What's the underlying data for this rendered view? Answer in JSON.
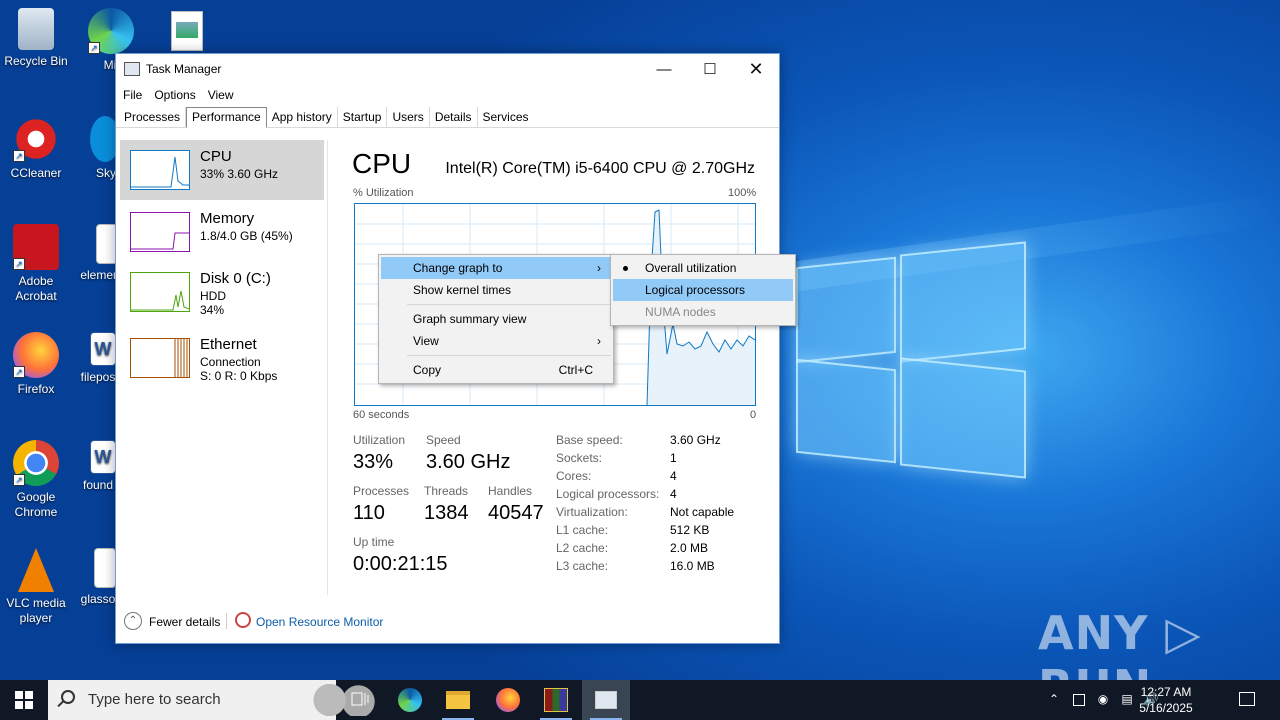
{
  "desktop": {
    "icons": [
      {
        "name": "recycle-bin-icon",
        "label": "Recycle Bin"
      },
      {
        "name": "edge-icon",
        "label": "Micro Ed"
      },
      {
        "name": "ccleaner-icon",
        "label": "CCleaner"
      },
      {
        "name": "skype-icon",
        "label": "Sky"
      },
      {
        "name": "acrobat-icon",
        "label": "Adobe Acrobat"
      },
      {
        "name": "element-icon",
        "label": "elemen"
      },
      {
        "name": "firefox-icon",
        "label": "Firefox"
      },
      {
        "name": "filepos-icon",
        "label": "filepos"
      },
      {
        "name": "chrome-icon",
        "label": "Google Chrome"
      },
      {
        "name": "found-icon",
        "label": "found"
      },
      {
        "name": "vlc-icon",
        "label": "VLC media player"
      },
      {
        "name": "glasso-icon",
        "label": "glasso"
      }
    ],
    "watermark": "ANY ▷ RUN"
  },
  "window": {
    "title": "Task Manager",
    "menu": [
      "File",
      "Options",
      "View"
    ],
    "tabs": [
      "Processes",
      "Performance",
      "App history",
      "Startup",
      "Users",
      "Details",
      "Services"
    ],
    "active_tab": "Performance"
  },
  "sidebar": {
    "items": [
      {
        "name": "CPU",
        "line2": "33%  3.60 GHz",
        "line3": "",
        "color": "#1178c5"
      },
      {
        "name": "Memory",
        "line2": "1.8/4.0 GB (45%)",
        "line3": "",
        "color": "#8b12ae"
      },
      {
        "name": "Disk 0 (C:)",
        "line2": "HDD",
        "line3": "34%",
        "color": "#4da60c"
      },
      {
        "name": "Ethernet",
        "line2": "Connection",
        "line3": "S: 0 R: 0 Kbps",
        "color": "#a74f01"
      }
    ]
  },
  "cpu": {
    "title": "CPU",
    "model": "Intel(R) Core(TM) i5-6400 CPU @ 2.70GHz",
    "graph_label_left": "% Utilization",
    "graph_label_right": "100%",
    "graph_bottom_left": "60 seconds",
    "graph_bottom_right": "0",
    "stats": {
      "utilization_label": "Utilization",
      "utilization": "33%",
      "speed_label": "Speed",
      "speed": "3.60 GHz",
      "processes_label": "Processes",
      "processes": "110",
      "threads_label": "Threads",
      "threads": "1384",
      "handles_label": "Handles",
      "handles": "40547",
      "uptime_label": "Up time",
      "uptime": "0:00:21:15"
    },
    "specs": [
      {
        "label": "Base speed:",
        "value": "3.60 GHz"
      },
      {
        "label": "Sockets:",
        "value": "1"
      },
      {
        "label": "Cores:",
        "value": "4"
      },
      {
        "label": "Logical processors:",
        "value": "4"
      },
      {
        "label": "Virtualization:",
        "value": "Not capable"
      },
      {
        "label": "L1 cache:",
        "value": "512 KB"
      },
      {
        "label": "L2 cache:",
        "value": "2.0 MB"
      },
      {
        "label": "L3 cache:",
        "value": "16.0 MB"
      }
    ]
  },
  "footer": {
    "fewer_details": "Fewer details",
    "open_resource_monitor": "Open Resource Monitor"
  },
  "context_menu": {
    "items": [
      "Change graph to",
      "Show kernel times",
      "Graph summary view",
      "View",
      "Copy"
    ],
    "copy_shortcut": "Ctrl+C"
  },
  "submenu": {
    "items": [
      "Overall utilization",
      "Logical processors",
      "NUMA nodes"
    ],
    "selected": "Overall utilization"
  },
  "taskbar": {
    "search_placeholder": "Type here to search",
    "time": "12:27 AM",
    "date": "5/16/2025"
  }
}
